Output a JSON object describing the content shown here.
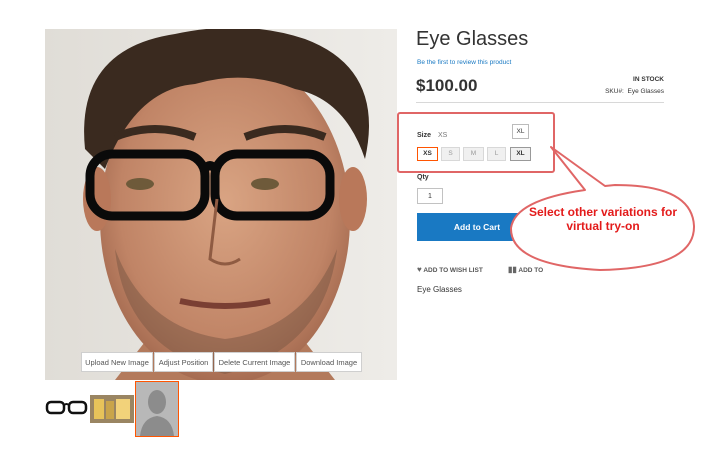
{
  "product": {
    "title": "Eye Glasses",
    "review_link": "Be the first to review this product",
    "price": "$100.00",
    "stock": "IN STOCK",
    "sku_label": "SKU#:",
    "sku_value": "Eye Glasses",
    "description": "Eye Glasses"
  },
  "image_controls": {
    "upload": "Upload New Image",
    "adjust": "Adjust Position",
    "delete": "Delete Current Image",
    "download": "Download Image"
  },
  "options": {
    "size_label": "Size",
    "selected_value": "XS",
    "sizes": [
      "XS",
      "S",
      "M",
      "L",
      "XL"
    ],
    "tooltip": "XL"
  },
  "quantity": {
    "label": "Qty",
    "value": "1"
  },
  "actions": {
    "add_to_cart": "Add to Cart",
    "wishlist": "ADD TO WISH LIST",
    "compare": "ADD TO"
  },
  "callout": {
    "text": "Select other variations for virtual try-on"
  },
  "colors": {
    "accent": "#1979c3",
    "selected_border": "#ff5501",
    "callout_red": "#e31b1b"
  }
}
